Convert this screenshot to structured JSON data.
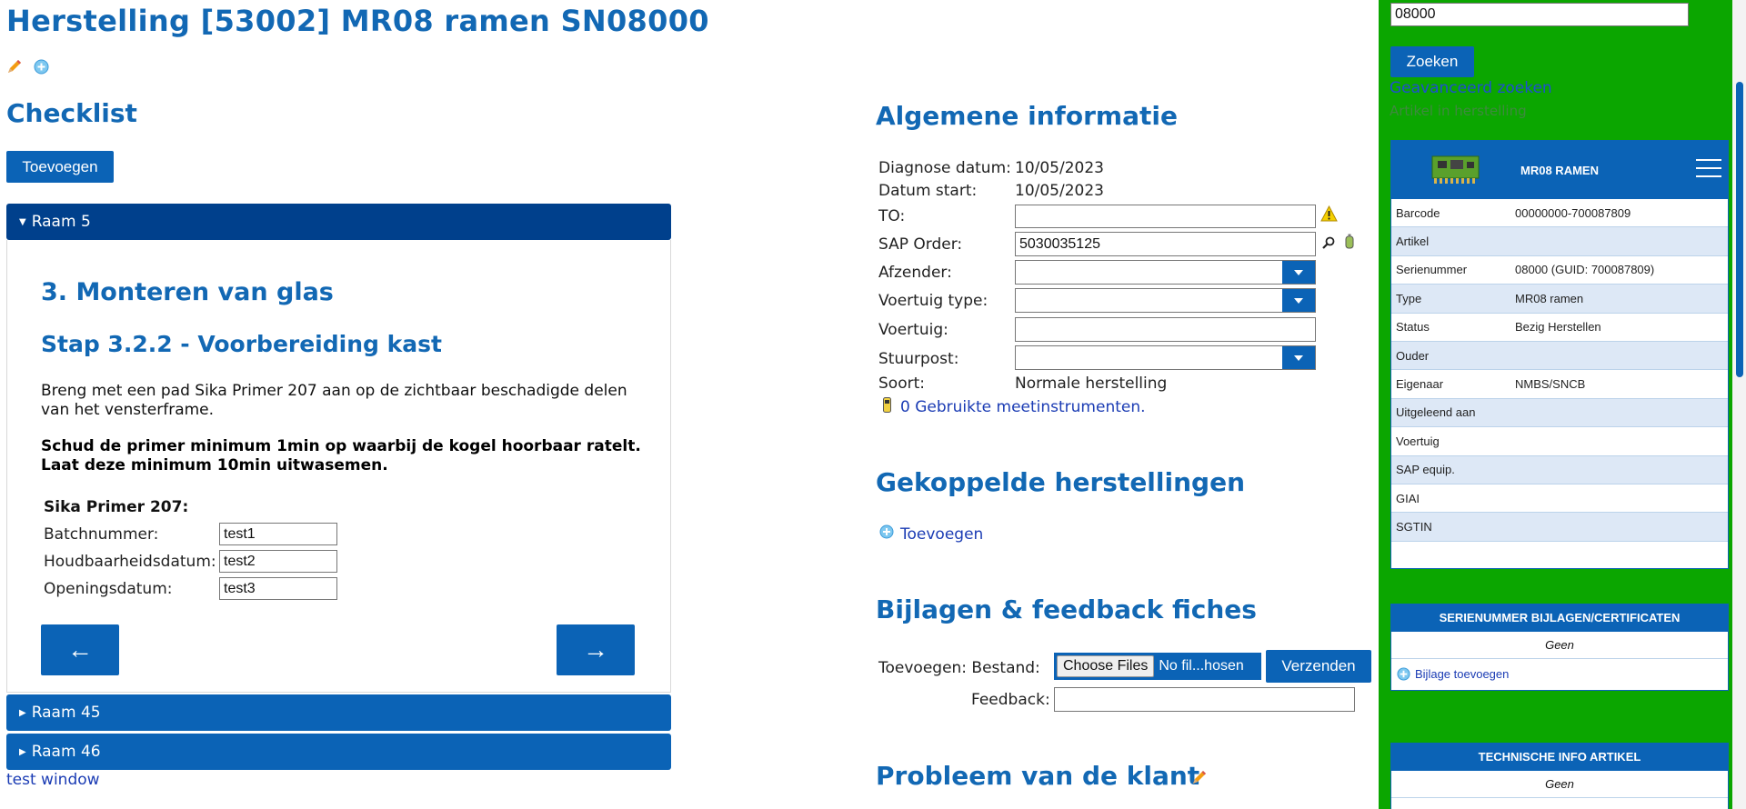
{
  "page": {
    "title": "Herstelling [53002] MR08 ramen SN08000",
    "test_link": "test window"
  },
  "checklist": {
    "heading": "Checklist",
    "add_button": "Toevoegen",
    "sections": [
      {
        "label": "Raam 5",
        "expanded": true
      },
      {
        "label": "Raam 45",
        "expanded": false
      },
      {
        "label": "Raam 46",
        "expanded": false
      }
    ],
    "step": {
      "heading": "3. Monteren van glas",
      "subheading": "Stap 3.2.2 - Voorbereiding kast",
      "text1": "Breng met een pad Sika Primer 207 aan op de zichtbaar beschadigde delen van het vensterframe.",
      "text2": "Schud de primer minimum 1min op waarbij de kogel hoorbaar ratelt. Laat deze minimum 10min uitwasemen.",
      "product_label": "Sika Primer 207:",
      "fields": [
        {
          "label": "Batchnummer:",
          "value": "test1"
        },
        {
          "label": "Houdbaarheidsdatum:",
          "value": "test2"
        },
        {
          "label": "Openingsdatum:",
          "value": "test3"
        }
      ],
      "prev_button": "←",
      "next_button": "→"
    }
  },
  "general": {
    "heading": "Algemene informatie",
    "diagnose_label": "Diagnose datum:",
    "diagnose_value": "10/05/2023",
    "start_label": "Datum start:",
    "start_value": "10/05/2023",
    "to_label": "TO:",
    "to_value": "",
    "sap_label": "SAP Order:",
    "sap_value": "5030035125",
    "afzender_label": "Afzender:",
    "voertuig_type_label": "Voertuig type:",
    "voertuig_label": "Voertuig:",
    "stuurpost_label": "Stuurpost:",
    "soort_label": "Soort:",
    "soort_value": "Normale herstelling",
    "instruments_link": "0 Gebruikte meetinstrumenten."
  },
  "linked": {
    "heading": "Gekoppelde herstellingen",
    "add_link": "Toevoegen"
  },
  "attachments": {
    "heading": "Bijlagen & feedback fiches",
    "add_label": "Toevoegen: Bestand:",
    "choose_button": "Choose Files",
    "no_file_text": "No fil...hosen",
    "send_button": "Verzenden",
    "feedback_label": "Feedback:"
  },
  "problem": {
    "heading": "Probleem van de klant"
  },
  "sidebar": {
    "search_value": "08000",
    "search_button": "Zoeken",
    "advanced_link": "Geavanceerd zoeken",
    "hidden_link": "Artikel in herstelling",
    "item_card": {
      "title": "MR08 RAMEN",
      "rows": [
        {
          "key": "Barcode",
          "value": "00000000-700087809"
        },
        {
          "key": "Artikel",
          "value": ""
        },
        {
          "key": "Serienummer",
          "value": "08000 (GUID: 700087809)"
        },
        {
          "key": "Type",
          "value": "MR08 ramen"
        },
        {
          "key": "Status",
          "value": "Bezig Herstellen"
        },
        {
          "key": "Ouder",
          "value": ""
        },
        {
          "key": "Eigenaar",
          "value": "NMBS/SNCB"
        },
        {
          "key": "Uitgeleend aan",
          "value": ""
        },
        {
          "key": "Voertuig",
          "value": ""
        },
        {
          "key": "SAP equip.",
          "value": ""
        },
        {
          "key": "GIAI",
          "value": ""
        },
        {
          "key": "SGTIN",
          "value": ""
        }
      ]
    },
    "attach_card": {
      "title": "SERIENUMMER BIJLAGEN/CERTIFICATEN",
      "empty": "Geen",
      "add_link": "Bijlage toevoegen"
    },
    "tech_card": {
      "title": "TECHNISCHE INFO ARTIKEL",
      "empty": "Geen"
    }
  },
  "colors": {
    "brand_blue": "#1268b4",
    "dark_blue": "#00408c",
    "sidebar_green": "#0ba600"
  }
}
